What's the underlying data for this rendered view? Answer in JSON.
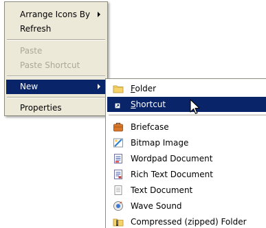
{
  "context_menu": {
    "items": [
      {
        "label": "Arrange Icons By",
        "has_submenu": true
      },
      {
        "label": "Refresh"
      },
      {
        "label": "Paste",
        "disabled": true
      },
      {
        "label": "Paste Shortcut",
        "disabled": true
      },
      {
        "label": "New",
        "has_submenu": true,
        "selected": true
      },
      {
        "label": "Properties"
      }
    ]
  },
  "new_submenu": {
    "items": [
      {
        "label_first": "F",
        "label_rest": "older",
        "icon": "folder-icon"
      },
      {
        "label_first": "S",
        "label_rest": "hortcut",
        "icon": "shortcut-icon",
        "selected": true
      },
      {
        "label": "Briefcase",
        "icon": "briefcase-icon"
      },
      {
        "label": "Bitmap Image",
        "icon": "bitmap-icon"
      },
      {
        "label": "Wordpad Document",
        "icon": "wordpad-icon"
      },
      {
        "label": "Rich Text Document",
        "icon": "rich-text-icon"
      },
      {
        "label": "Text Document",
        "icon": "text-document-icon"
      },
      {
        "label": "Wave Sound",
        "icon": "wave-sound-icon"
      },
      {
        "label": "Compressed (zipped) Folder",
        "icon": "zip-folder-icon"
      }
    ]
  },
  "colors": {
    "menu_background": "#ece9d8",
    "highlight": "#0a246a",
    "disabled_text": "#aca899"
  }
}
